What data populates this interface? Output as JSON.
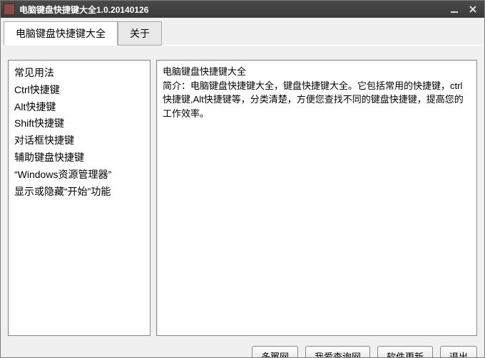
{
  "titlebar": {
    "title": "电脑键盘快捷键大全1.0.20140126"
  },
  "tabs": {
    "main": "电脑键盘快捷键大全",
    "about": "关于"
  },
  "sidebar": {
    "items": [
      "常见用法",
      "Ctrl快捷键",
      "Alt快捷键",
      "Shift快捷键",
      "对话框快捷键",
      "辅助键盘快捷键",
      "“Windows资源管理器”",
      "显示或隐藏“开始”功能"
    ]
  },
  "main": {
    "heading": "电脑键盘快捷键大全",
    "body": "简介：电脑键盘快捷键大全，键盘快捷键大全。它包括常用的快捷键，ctrl快捷键,Alt快捷键等，分类清楚，方便您查找不同的键盘快捷键，提高您的工作效率。"
  },
  "buttons": {
    "duote": "多翼网",
    "woaichaxun": "我爱查询网",
    "update": "软件更新",
    "exit": "退出"
  }
}
